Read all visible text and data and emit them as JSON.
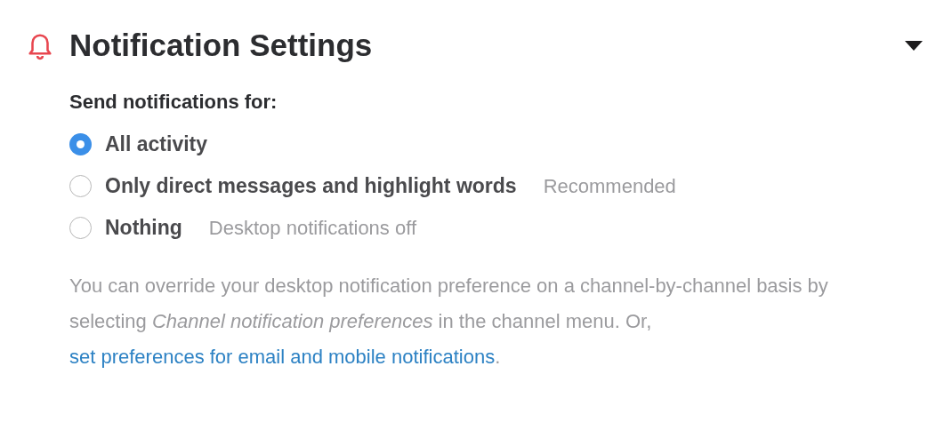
{
  "section": {
    "title": "Notification Settings",
    "expanded": true
  },
  "prompt": "Send notifications for:",
  "options": [
    {
      "label": "All activity",
      "selected": true
    },
    {
      "label": "Only direct messages and highlight words",
      "hint": "Recommended",
      "selected": false
    },
    {
      "label": "Nothing",
      "hint": "Desktop notifications off",
      "selected": false
    }
  ],
  "help_text": "You can override your desktop notification preference on a channel-by-channel basis by selecting *Channel notification preferences* in the channel menu. Or,",
  "help_link": "set preferences for email and mobile notifications",
  "help_end": "."
}
